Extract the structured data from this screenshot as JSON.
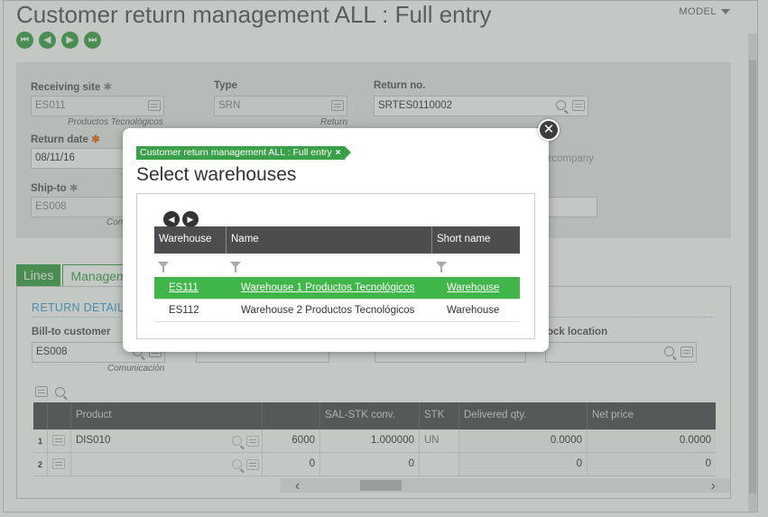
{
  "page": {
    "title": "Customer return management ALL : Full entry",
    "model_label": "MODEL"
  },
  "header": {
    "receiving_site": {
      "label": "Receiving site",
      "value": "ES011",
      "sub": "Productos Tecnológicos"
    },
    "type": {
      "label": "Type",
      "value": "SRN",
      "sub": "Return"
    },
    "return_no": {
      "label": "Return no.",
      "value": "SRTES0110002"
    },
    "return_date": {
      "label": "Return date",
      "value": "08/11/16"
    },
    "intercompany": "ercompany",
    "ship_to": {
      "label": "Ship-to",
      "value": "ES008",
      "sub": "Com"
    }
  },
  "tabs": [
    {
      "label": "Lines"
    },
    {
      "label": "Managem"
    }
  ],
  "lines": {
    "section_title": "RETURN DETAIL",
    "bill_to": {
      "label": "Bill-to customer",
      "value": "ES008",
      "sub": "Comunicación"
    },
    "stock_location_label": "ock location",
    "columns": [
      "Product",
      "",
      "SAL-STK conv.",
      "STK",
      "Delivered qty.",
      "Net price"
    ],
    "rows": [
      {
        "no": "1",
        "product": "DIS010",
        "qty": "6000",
        "conv": "1.000000",
        "stk": "UN",
        "delivered": "0.0000",
        "price": "0.0000"
      },
      {
        "no": "2",
        "product": "",
        "qty": "0",
        "conv": "0",
        "stk": "",
        "delivered": "0",
        "price": "0"
      }
    ]
  },
  "modal": {
    "crumb": "Customer return management ALL : Full entry",
    "title": "Select warehouses",
    "columns": {
      "warehouse": "Warehouse",
      "name": "Name",
      "short_name": "Short name"
    },
    "rows": [
      {
        "warehouse": "ES111",
        "name": "Warehouse 1 Productos Tecnológicos",
        "short_name": "Warehouse",
        "selected": true
      },
      {
        "warehouse": "ES112",
        "name": "Warehouse 2 Productos Tecnológicos",
        "short_name": "Warehouse",
        "selected": false
      }
    ]
  },
  "colors": {
    "accent": "#3aa14a",
    "header_dark": "#4d4d4f",
    "link_blue": "#3aa0d8"
  }
}
